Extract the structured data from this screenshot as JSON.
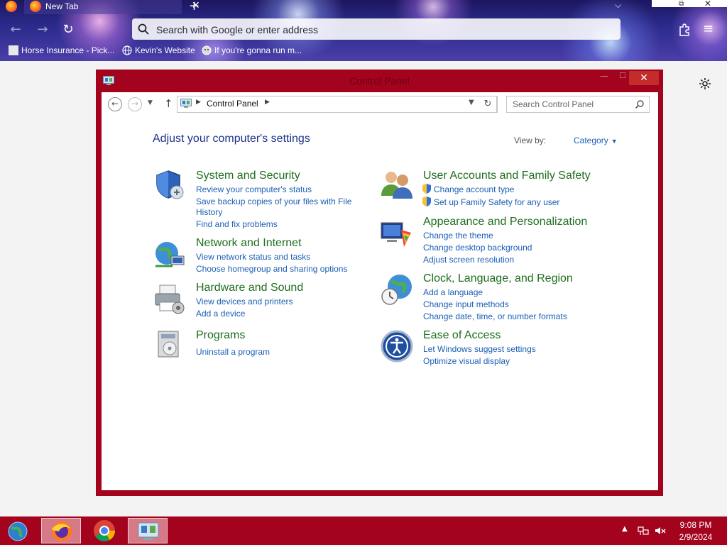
{
  "browser": {
    "tab_title": "New Tab",
    "url_placeholder": "Search with Google or enter address",
    "bookmarks": [
      {
        "label": "Horse Insurance - Pick..."
      },
      {
        "label": "Kevin's Website"
      },
      {
        "label": "If you're gonna run m..."
      }
    ]
  },
  "window": {
    "title": "Control Panel",
    "close_glyph": "✕",
    "min_glyph": "—",
    "max_glyph": "☐"
  },
  "address": {
    "crumb": "Control Panel",
    "search_placeholder": "Search Control Panel"
  },
  "main": {
    "heading": "Adjust your computer's settings",
    "view_by_label": "View by:",
    "view_by_value": "Category"
  },
  "categories": [
    {
      "title": "System and Security",
      "links": [
        "Review your computer's status",
        "Save backup copies of your files with File",
        "History",
        "Find and fix problems"
      ]
    },
    {
      "title": "Network and Internet",
      "links": [
        "View network status and tasks",
        "Choose homegroup and sharing options"
      ]
    },
    {
      "title": "Hardware and Sound",
      "links": [
        "View devices and printers",
        "Add a device"
      ]
    },
    {
      "title": "Programs",
      "links": [
        "Uninstall a program"
      ]
    },
    {
      "title": "User Accounts and Family Safety",
      "links": [
        "Change account type",
        "Set up Family Safety for any user"
      ]
    },
    {
      "title": "Appearance and Personalization",
      "links": [
        "Change the theme",
        "Change desktop background",
        "Adjust screen resolution"
      ]
    },
    {
      "title": "Clock, Language, and Region",
      "links": [
        "Add a language",
        "Change input methods",
        "Change date, time, or number formats"
      ]
    },
    {
      "title": "Ease of Access",
      "links": [
        "Let Windows suggest settings",
        "Optimize visual display"
      ]
    }
  ],
  "taskbar": {
    "time": "9:08 PM",
    "date": "2/9/2024"
  },
  "colors": {
    "window_frame": "#a3031d",
    "category_title": "#1f6e1f",
    "link": "#1a5fb4",
    "heading": "#1e3287"
  }
}
